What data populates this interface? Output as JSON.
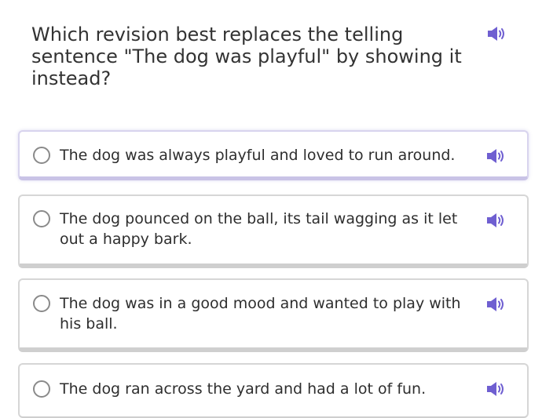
{
  "question": {
    "text": "Which revision best replaces the telling sentence \"The dog was playful\" by showing it instead?",
    "speaker_icon": "speaker-icon"
  },
  "choices": [
    {
      "text": "The dog was always playful and loved to run around.",
      "selected": true
    },
    {
      "text": "The dog pounced on the ball, its tail wagging as it let out a happy bark.",
      "selected": false
    },
    {
      "text": "The dog was in a good mood and wanted to play with his ball.",
      "selected": false
    },
    {
      "text": "The dog ran across the yard and had a lot of fun.",
      "selected": false
    }
  ],
  "colors": {
    "speaker": "#6f5fd1",
    "selected_border": "#d8d4ee"
  }
}
